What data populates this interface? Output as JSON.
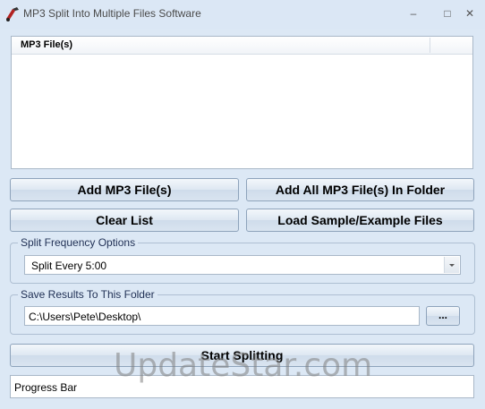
{
  "window": {
    "title": "MP3 Split Into Multiple Files Software",
    "minimize_glyph": "–",
    "maximize_glyph": "□",
    "close_glyph": "✕"
  },
  "file_list": {
    "column_header": "MP3 File(s)"
  },
  "buttons": {
    "add_files": "Add MP3 File(s)",
    "add_folder": "Add All MP3 File(s) In Folder",
    "clear_list": "Clear List",
    "load_sample": "Load Sample/Example Files",
    "browse": "...",
    "start": "Start Splitting"
  },
  "split_options": {
    "legend": "Split Frequency Options",
    "selected": "Split Every 5:00"
  },
  "save_folder": {
    "legend": "Save Results To This Folder",
    "path": "C:\\Users\\Pete\\Desktop\\"
  },
  "progress": {
    "label": "Progress Bar"
  },
  "watermark": {
    "text": "UpdateStar.com"
  }
}
